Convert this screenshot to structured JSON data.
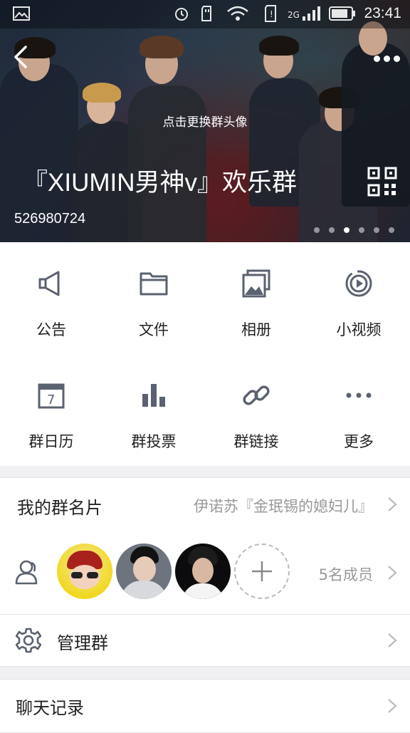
{
  "status_bar": {
    "network": "2G",
    "time": "23:41"
  },
  "header": {
    "change_avatar_hint": "点击更换群头像",
    "group_name": "『XIUMIN男神v』欢乐群",
    "group_id": "526980724",
    "carousel": {
      "total": 6,
      "active": 3
    }
  },
  "features": [
    {
      "label": "公告",
      "icon": "megaphone-icon"
    },
    {
      "label": "文件",
      "icon": "folder-icon"
    },
    {
      "label": "相册",
      "icon": "album-icon"
    },
    {
      "label": "小视频",
      "icon": "video-icon"
    },
    {
      "label": "群日历",
      "icon": "calendar-icon",
      "day": "7"
    },
    {
      "label": "群投票",
      "icon": "bar-chart-icon"
    },
    {
      "label": "群链接",
      "icon": "link-icon"
    },
    {
      "label": "更多",
      "icon": "more-icon"
    }
  ],
  "my_card": {
    "label": "我的群名片",
    "value": "伊诺苏『金珉锡的媳妇儿』"
  },
  "members": {
    "count_label": "5名成员"
  },
  "manage": {
    "label": "管理群"
  },
  "chat_history": {
    "label": "聊天记录"
  },
  "colors": {
    "icon_gray": "#5a6170",
    "text_gray": "#999999",
    "divider": "#e2e2e2",
    "page_bg": "#f0f0f2"
  }
}
